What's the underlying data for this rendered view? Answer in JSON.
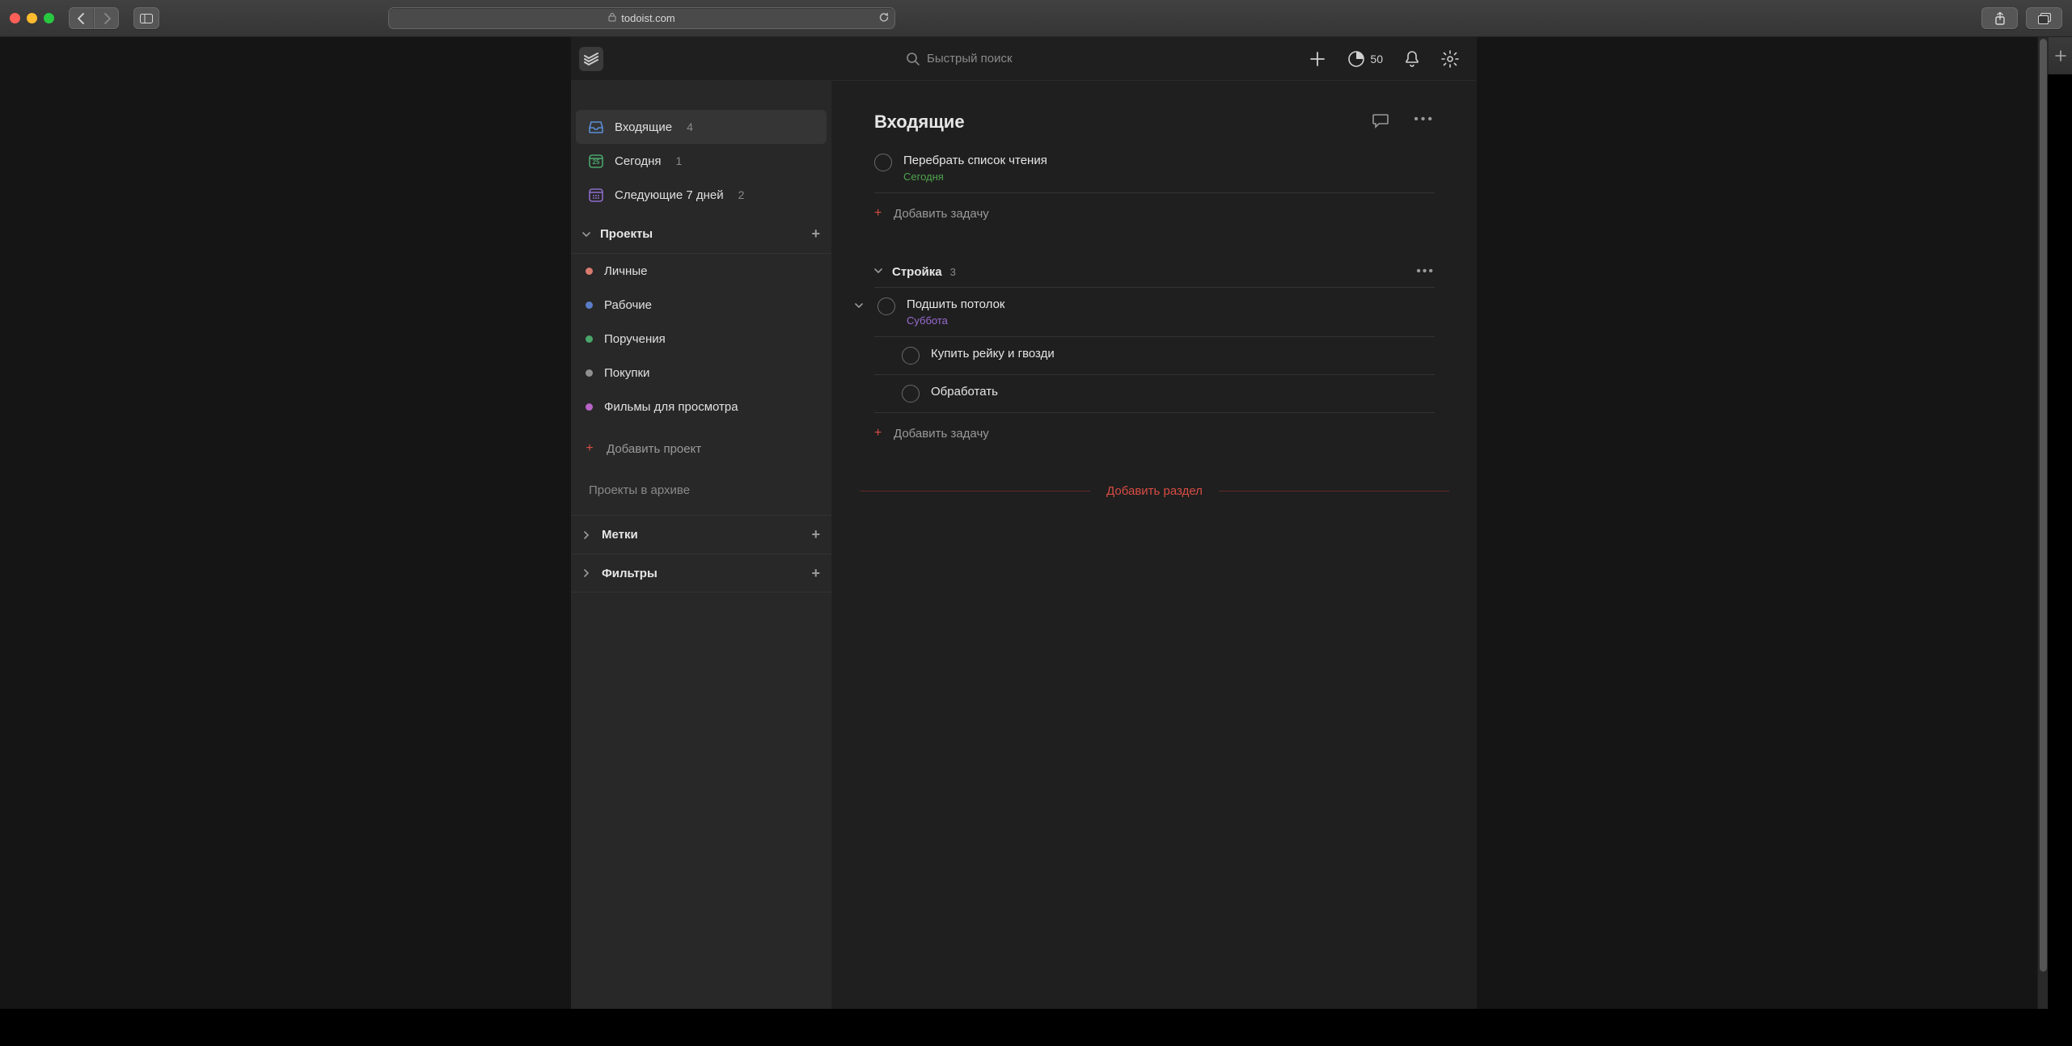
{
  "browser": {
    "url": "todoist.com"
  },
  "header": {
    "search_placeholder": "Быстрый поиск",
    "productivity_score": "50"
  },
  "sidebar": {
    "groups": {
      "inbox": {
        "label": "Входящие",
        "count": "4"
      },
      "today": {
        "label": "Сегодня",
        "count": "1",
        "day_number": "25"
      },
      "upcoming": {
        "label": "Следующие 7 дней",
        "count": "2"
      }
    },
    "projects_header": "Проекты",
    "projects": [
      {
        "label": "Личные",
        "color": "#d87a6e"
      },
      {
        "label": "Рабочие",
        "color": "#5a7cc7"
      },
      {
        "label": "Поручения",
        "color": "#4aa66a"
      },
      {
        "label": "Покупки",
        "color": "#8f8f8f"
      },
      {
        "label": "Фильмы для просмотра",
        "color": "#b763c6"
      }
    ],
    "add_project_label": "Добавить проект",
    "archive_label": "Проекты в архиве",
    "labels_header": "Метки",
    "filters_header": "Фильтры"
  },
  "content": {
    "title": "Входящие",
    "tasks": [
      {
        "title": "Перебрать список чтения",
        "date_label": "Сегодня",
        "date_class": "today"
      }
    ],
    "add_task_label": "Добавить задачу",
    "section": {
      "name": "Стройка",
      "count": "3",
      "tasks": [
        {
          "title": "Подшить потолок",
          "date_label": "Суббота",
          "date_class": "future",
          "has_sub": true
        },
        {
          "title": "Купить рейку и гвозди",
          "sub": true
        },
        {
          "title": "Обработать",
          "sub": true
        }
      ]
    },
    "add_section_label": "Добавить раздел"
  },
  "colors": {
    "accent": "#d74d44"
  }
}
